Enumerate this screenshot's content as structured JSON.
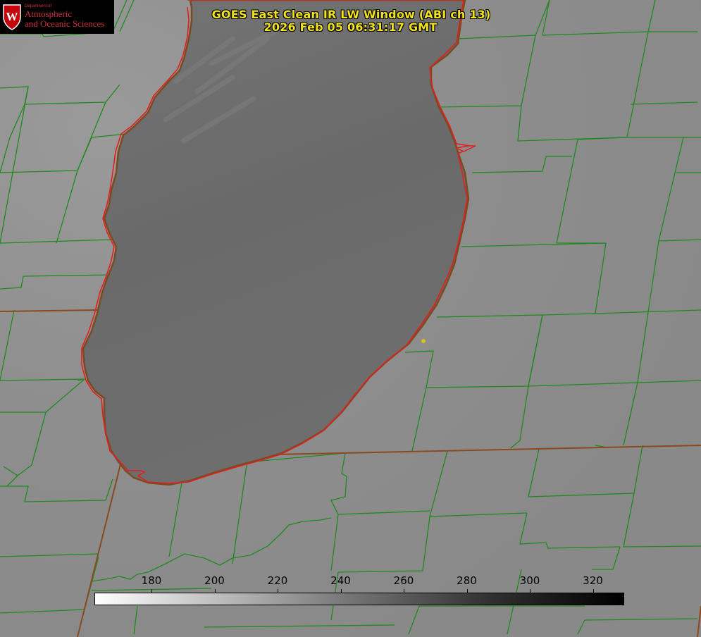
{
  "title": {
    "line1": "GOES East Clean IR LW Window (ABI ch 13)",
    "line2": "2026 Feb 05 06:31:17 GMT"
  },
  "logo": {
    "department": "Department of",
    "name_line1": "Atmospheric",
    "name_line2": "and Oceanic Sciences"
  },
  "colorbar": {
    "ticks": [
      "180",
      "200",
      "220",
      "240",
      "260",
      "280",
      "300",
      "320"
    ],
    "ramp_colors": [
      "#ffffff",
      "#b8b8b8",
      "#707070",
      "#303030",
      "#000000"
    ]
  },
  "colors": {
    "land": "#8c8c8c",
    "lake": "#6a6a6a",
    "county_lines": "#1f8a1f",
    "shoreline": "#e02020",
    "state_lines": "#8a4a20",
    "title_text": "#f2e31a",
    "marker": "#d8c21a"
  }
}
